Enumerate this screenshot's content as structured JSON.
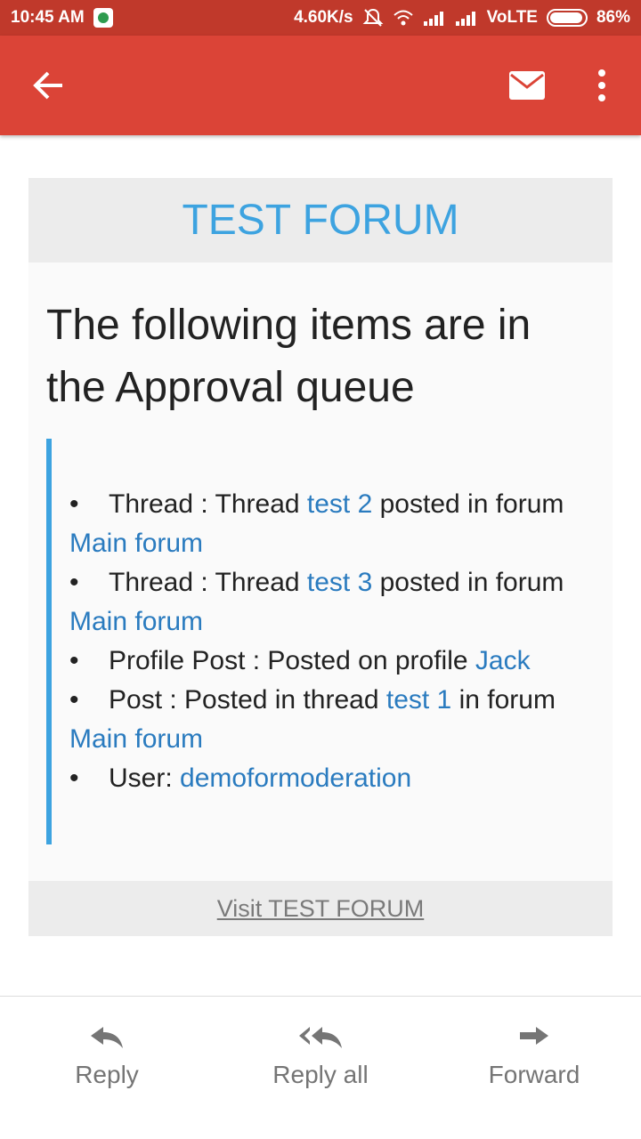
{
  "status_bar": {
    "time": "10:45 AM",
    "net_speed": "4.60K/s",
    "network": "VoLTE",
    "battery": "86%"
  },
  "app_bar": {
    "icons": [
      "back-arrow-icon",
      "mail-icon",
      "more-vert-icon"
    ]
  },
  "email": {
    "forum_title": "TEST FORUM",
    "heading": "The following items are in the Approval queue",
    "items": [
      {
        "prefix": "Thread : Thread ",
        "link": "test 2",
        "suffix": " posted in forum ",
        "link2": "Main forum"
      },
      {
        "prefix": "Thread : Thread ",
        "link": "test 3",
        "suffix": " posted in forum ",
        "link2": "Main forum"
      },
      {
        "prefix": "Profile Post : Posted on profile ",
        "link": "Jack",
        "suffix": "",
        "link2": ""
      },
      {
        "prefix": "Post : Posted in thread ",
        "link": "test 1",
        "suffix": " in forum ",
        "link2": "Main forum"
      },
      {
        "prefix": "User: ",
        "link": "demoformoderation",
        "suffix": "",
        "link2": ""
      }
    ],
    "footer_link": "Visit TEST FORUM"
  },
  "actions": {
    "reply": "Reply",
    "reply_all": "Reply all",
    "forward": "Forward"
  },
  "colors": {
    "app_bar": "#db4437",
    "status_bar": "#c0392b",
    "accent": "#3da3e0",
    "link": "#2a7bbf"
  }
}
